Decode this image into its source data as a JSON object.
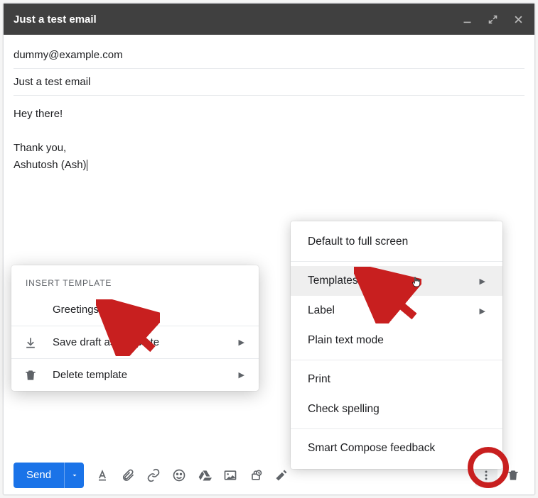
{
  "window": {
    "title": "Just a test email"
  },
  "compose": {
    "to": "dummy@example.com",
    "subject": "Just a test email",
    "body_lines": {
      "line1": "Hey there!",
      "line2": "Thank you,",
      "line3": "Ashutosh (Ash)"
    }
  },
  "bottom": {
    "send_label": "Send"
  },
  "more_menu": {
    "default_fullscreen": "Default to full screen",
    "templates": "Templates",
    "label": "Label",
    "plain_text": "Plain text mode",
    "print": "Print",
    "check_spelling": "Check spelling",
    "smart_compose": "Smart Compose feedback"
  },
  "templates_menu": {
    "header": "INSERT TEMPLATE",
    "greetings": "Greetings",
    "save_draft": "Save draft as template",
    "delete": "Delete template"
  }
}
